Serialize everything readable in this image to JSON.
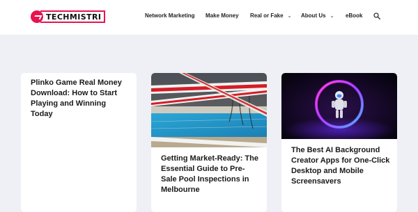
{
  "header": {
    "logo_text": "TECHMISTRI",
    "nav": [
      {
        "label": "Network Marketing",
        "has_dropdown": false
      },
      {
        "label": "Make Money",
        "has_dropdown": false
      },
      {
        "label": "Real or Fake",
        "has_dropdown": true
      },
      {
        "label": "About Us",
        "has_dropdown": true
      },
      {
        "label": "eBook",
        "has_dropdown": false
      }
    ],
    "search_icon": "search-icon"
  },
  "posts": [
    {
      "title": "Plinko Game Real Money Download: How to Start Playing and Winning Today",
      "has_image": false
    },
    {
      "title": "Getting Market-Ready: The Essential Guide to Pre-Sale Pool Inspections in Melbourne",
      "has_image": true,
      "image": "pool-danger-tape-image"
    },
    {
      "title": "The Best AI Background Creator Apps for One-Click Desktop and Mobile Screensavers",
      "has_image": true,
      "image": "astronaut-neon-ring-image"
    }
  ],
  "colors": {
    "accent": "#e8124f",
    "background": "#eef0f5",
    "card": "#ffffff"
  }
}
